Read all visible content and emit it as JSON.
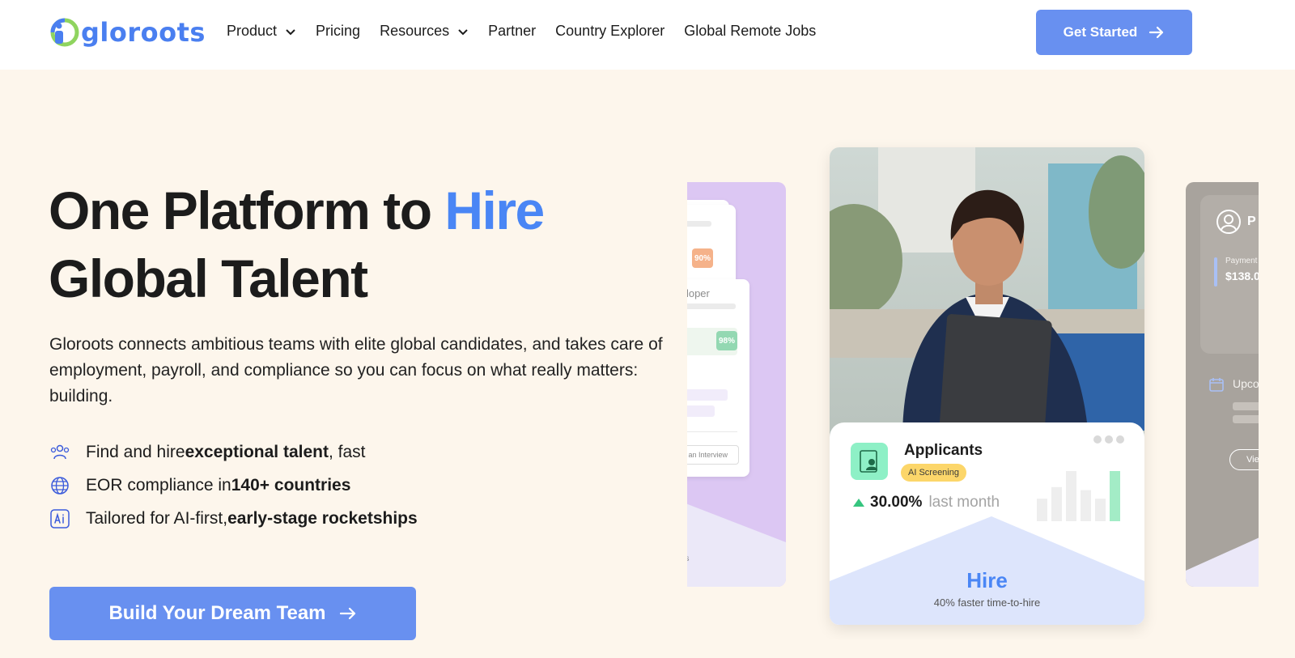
{
  "brand": {
    "name": "gloroots"
  },
  "nav": {
    "items": [
      {
        "label": "Product",
        "dropdown": true
      },
      {
        "label": "Pricing",
        "dropdown": false
      },
      {
        "label": "Resources",
        "dropdown": true
      },
      {
        "label": "Partner",
        "dropdown": false
      },
      {
        "label": "Country Explorer",
        "dropdown": false
      },
      {
        "label": "Global Remote Jobs",
        "dropdown": false
      }
    ],
    "cta_label": "Get Started"
  },
  "hero": {
    "title_part1": "One Platform to ",
    "title_highlight": "Hire",
    "title_part2": "Global Talent",
    "description": "Gloroots connects ambitious teams with elite global candidates, and takes care of employment, payroll, and compliance so you can focus on what really matters: building.",
    "features": [
      {
        "icon": "people-icon",
        "pre": "Find and hire ",
        "bold": "exceptional talent",
        "post": ", fast"
      },
      {
        "icon": "globe-icon",
        "pre": "EOR compliance in ",
        "bold": "140+ countries",
        "post": ""
      },
      {
        "icon": "ai-icon",
        "pre": "Tailored for AI-first, ",
        "bold": "early-stage rocketships",
        "post": ""
      }
    ],
    "cta_label": "Build Your Dream Team"
  },
  "carousel": {
    "left_card": {
      "badge_top": "90%",
      "role_text": "eveloper",
      "badge_mid": "98%",
      "action_text": "edule an Interview",
      "footer_text": "es"
    },
    "main_card": {
      "title": "Applicants",
      "badge": "AI Screening",
      "stat_value": "30.00%",
      "stat_label": "last month",
      "bars": [
        0.45,
        0.68,
        1.0,
        0.62,
        0.45,
        1.0
      ],
      "hire_title": "Hire",
      "hire_subtitle": "40% faster time-to-hire"
    },
    "right_card": {
      "profile_text": "P",
      "payment_label": "Payment",
      "payment_value": "$138.0",
      "upcoming_label": "Upco",
      "view_label": "Vie"
    }
  },
  "colors": {
    "accent": "#4a86f5",
    "button": "#6890f0",
    "hero_bg": "#fdf6ec",
    "mint": "#8ef0c6",
    "badge_yellow": "#fcd66a",
    "lavender": "#dcc7f3"
  }
}
